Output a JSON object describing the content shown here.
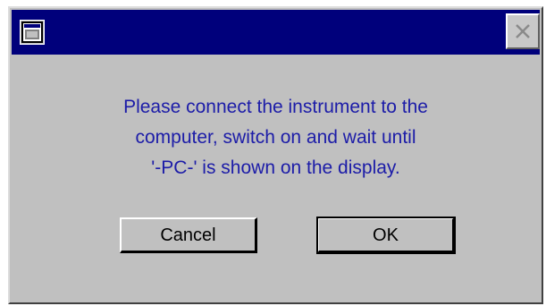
{
  "dialog": {
    "title": "",
    "message_lines": [
      "Please connect the instrument to the",
      "computer, switch on and wait until",
      "'-PC-' is shown on the display."
    ],
    "buttons": {
      "cancel_label": "Cancel",
      "ok_label": "OK"
    }
  },
  "icons": {
    "app": "window-app-icon",
    "close": "close-icon"
  },
  "colors": {
    "titlebar": "#00007b",
    "dialog_face": "#c0c0c0",
    "message_text": "#1c1ca8"
  }
}
